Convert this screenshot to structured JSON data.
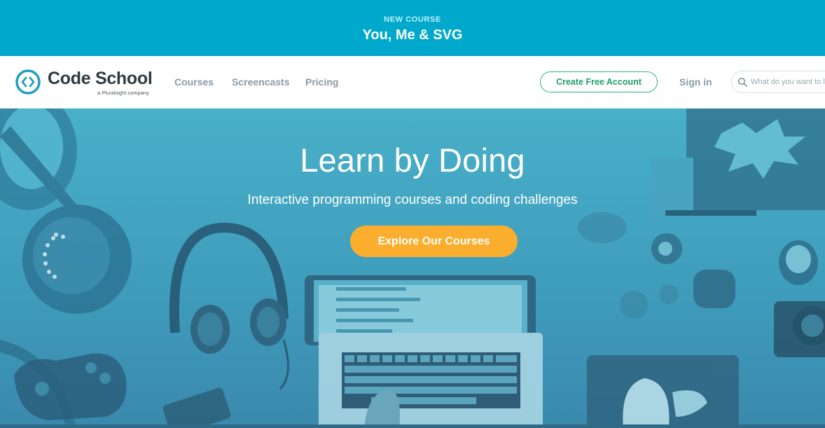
{
  "banner": {
    "eyebrow": "NEW COURSE",
    "title": "You, Me & SVG"
  },
  "nav": {
    "logo": {
      "wordmark": "Code School",
      "tagline": "a Pluralsight company"
    },
    "links": [
      "Courses",
      "Screencasts",
      "Pricing"
    ],
    "create_account": "Create Free Account",
    "sign_in": "Sign in",
    "search": {
      "placeholder": "What do you want to learn?"
    }
  },
  "hero": {
    "headline": "Learn by Doing",
    "subheadline": "Interactive programming courses and coding challenges",
    "cta": "Explore Our Courses"
  },
  "colors": {
    "banner": "#00a9cb",
    "hero_tint": "#41a6c2",
    "cta_orange": "#fbad2d",
    "cta_green": "#2bb481",
    "logo_blue": "#1d9fc0",
    "nav_text": "#8a9ba3"
  },
  "icons": {
    "logo": "code-brackets-icon",
    "search": "magnifier-icon"
  }
}
